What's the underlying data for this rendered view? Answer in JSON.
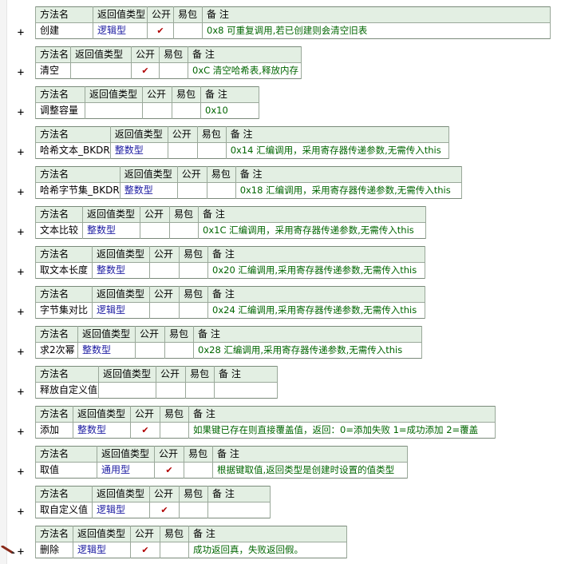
{
  "headers": {
    "method": "方法名",
    "return_type": "返回值类型",
    "public": "公开",
    "easy_pack": "易包",
    "note": "备 注"
  },
  "expand_glyph": "+",
  "check_glyph": "✔",
  "icons": {
    "edit_pen": "pencil-icon"
  },
  "colors": {
    "header_bg": "#e3efe3",
    "type_text": "#1a1aa0",
    "note_text": "#006600",
    "check": "#b00000"
  },
  "methods": [
    {
      "name": "创建",
      "type": "逻辑型",
      "public": true,
      "note": "0x8  可重复调用,若已创建则会清空旧表"
    },
    {
      "name": "清空",
      "type": "",
      "public": true,
      "note": "0xC 清空哈希表,释放内存"
    },
    {
      "name": "调整容量",
      "type": "",
      "public": false,
      "note": "0x10"
    },
    {
      "name": "哈希文本_BKDR",
      "type": "整数型",
      "public": false,
      "note": "0x14 汇编调用，采用寄存器传递参数,无需传入this"
    },
    {
      "name": "哈希字节集_BKDR",
      "type": "整数型",
      "public": false,
      "note": "0x18 汇编调用，采用寄存器传递参数,无需传入this"
    },
    {
      "name": "文本比较",
      "type": "整数型",
      "public": false,
      "note": "0x1C 汇编调用，采用寄存器传递参数,无需传入this"
    },
    {
      "name": "取文本长度",
      "type": "整数型",
      "public": false,
      "note": "0x20 汇编调用,采用寄存器传递参数,无需传入this"
    },
    {
      "name": "字节集对比",
      "type": "逻辑型",
      "public": false,
      "note": "0x24 汇编调用,采用寄存器传递参数,无需传入this"
    },
    {
      "name": "求2次幂",
      "type": "整数型",
      "public": false,
      "note": "0x28 汇编调用,采用寄存器传递参数,无需传入this"
    },
    {
      "name": "释放自定义值",
      "type": "",
      "public": false,
      "note": ""
    },
    {
      "name": "添加",
      "type": "整数型",
      "public": true,
      "note": "如果键已存在则直接覆盖值，返回：0=添加失败  1=成功添加  2=覆盖"
    },
    {
      "name": "取值",
      "type": "通用型",
      "public": true,
      "note": "根据键取值,返回类型是创建时设置的值类型"
    },
    {
      "name": "取自定义值",
      "type": "逻辑型",
      "public": true,
      "note": ""
    },
    {
      "name": "删除",
      "type": "逻辑型",
      "public": true,
      "note": "成功返回真，失败返回假。"
    }
  ]
}
